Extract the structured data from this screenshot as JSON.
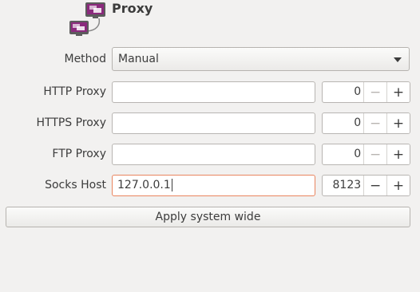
{
  "header": {
    "title": "Proxy",
    "icon": "network-proxy-icon"
  },
  "method": {
    "label": "Method",
    "selected": "Manual",
    "icon": "chevron-down-icon"
  },
  "http": {
    "label": "HTTP Proxy",
    "host": "",
    "port": "0"
  },
  "https": {
    "label": "HTTPS Proxy",
    "host": "",
    "port": "0"
  },
  "ftp": {
    "label": "FTP Proxy",
    "host": "",
    "port": "0"
  },
  "socks": {
    "label": "Socks Host",
    "host": "127.0.0.1",
    "port": "8123"
  },
  "spin_buttons": {
    "minus": "−",
    "plus": "+"
  },
  "apply_button": {
    "label": "Apply system wide"
  },
  "colors": {
    "background": "#f2f1f0",
    "focus_border": "#e9855f",
    "icon_purple": "#8b2a7d"
  }
}
